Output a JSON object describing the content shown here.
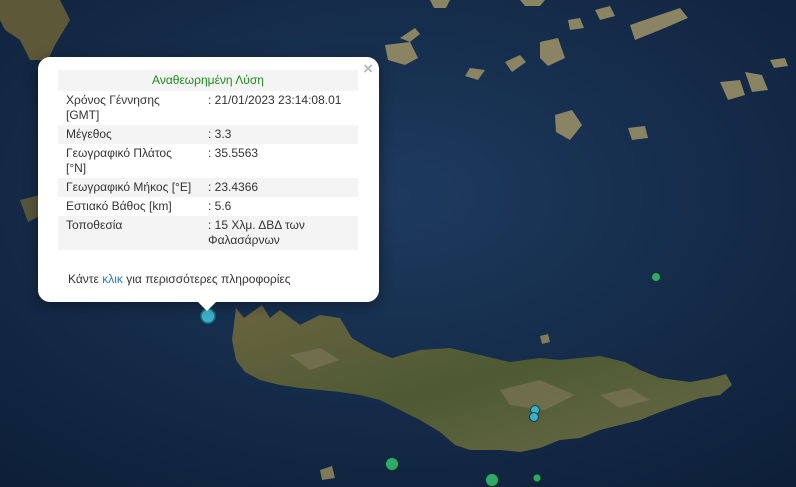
{
  "popup": {
    "title": "Αναθεωρημένη Λύση",
    "close_glyph": "×",
    "rows": [
      {
        "label": "Χρόνος Γέννησης [GMT]",
        "value": ": 21/01/2023 23:14:08.01"
      },
      {
        "label": "Μέγεθος",
        "value": ": 3.3"
      },
      {
        "label": "Γεωγραφικό Πλάτος [°N]",
        "value": ": 35.5563"
      },
      {
        "label": "Γεωγραφικό Μήκος [°E]",
        "value": ": 23.4366"
      },
      {
        "label": "Εστιακό Βάθος [km]",
        "value": ": 5.6"
      },
      {
        "label": "Τοποθεσία",
        "value": ": 15 Χλμ. ΔΒΔ των Φαλασάρνων"
      }
    ],
    "more_prefix": "Κάντε",
    "more_link": "κλικ",
    "more_suffix": "για περισσότερες πληροφορίες"
  },
  "colors": {
    "sea_deep": "#0f2440",
    "sea": "#1a3456",
    "land": "#5b5a3a",
    "land_green": "#3e5a2c",
    "selected_marker": "#3bb0c9",
    "marker_green": "#2fa86a"
  },
  "markers": [
    {
      "name": "selected-event",
      "magnitude": 3.3
    },
    {
      "name": "event",
      "magnitude": 2.5
    },
    {
      "name": "event",
      "magnitude": 2.6
    },
    {
      "name": "event",
      "magnitude": 2.5
    },
    {
      "name": "event",
      "magnitude": 3.4
    },
    {
      "name": "event",
      "magnitude": 3.5
    },
    {
      "name": "event",
      "magnitude": 2.4
    }
  ]
}
